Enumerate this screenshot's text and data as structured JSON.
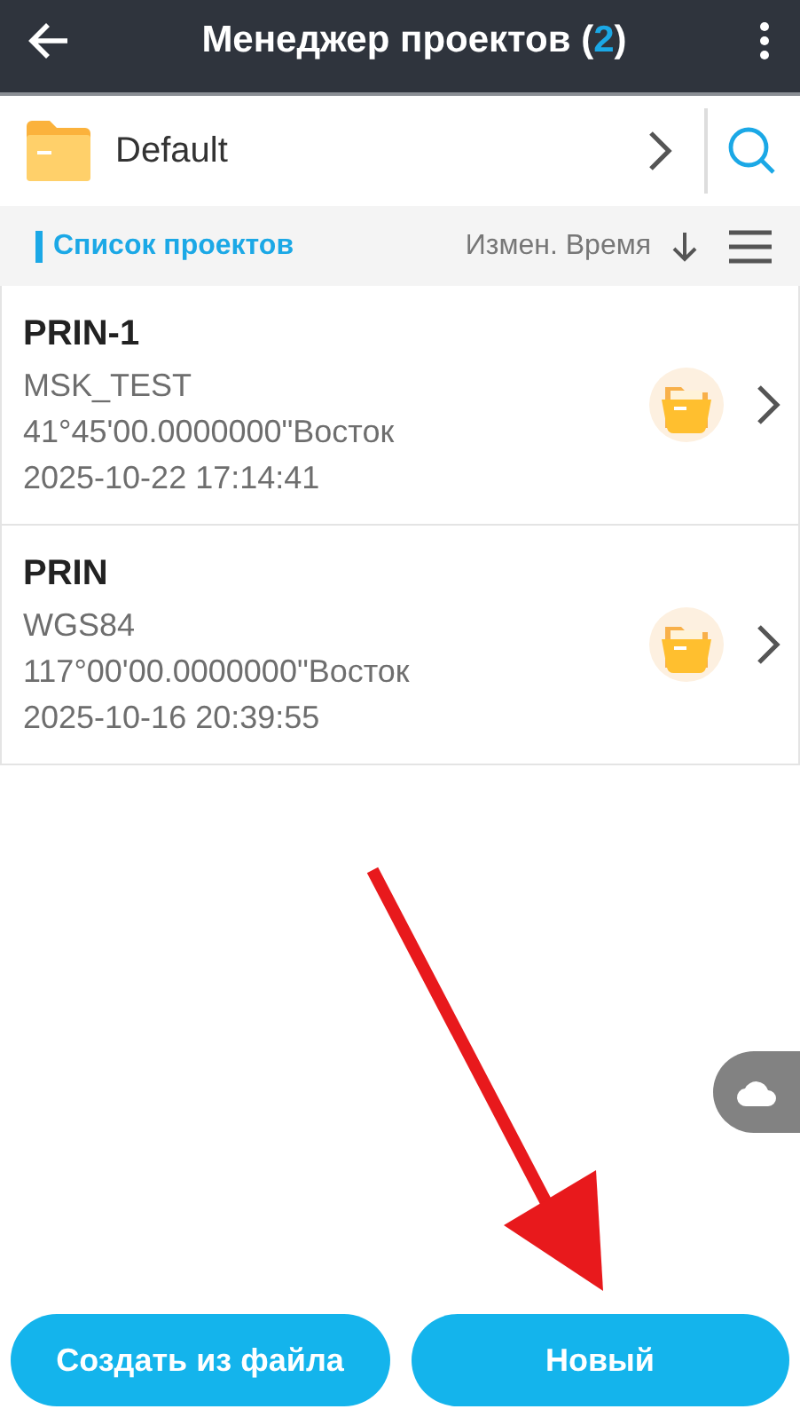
{
  "header": {
    "title_start": "Менеджер проектов (",
    "count": "2",
    "title_end": ")"
  },
  "folder": {
    "name": "Default"
  },
  "list_bar": {
    "title": "Список проектов",
    "sort_label": "Измен. Время"
  },
  "projects": [
    {
      "name": "PRIN-1",
      "system": "MSK_TEST",
      "meridian": "41°45'00.0000000\"Восток",
      "time": "2025-10-22 17:14:41"
    },
    {
      "name": "PRIN",
      "system": "WGS84",
      "meridian": "117°00'00.0000000\"Восток",
      "time": "2025-10-16 20:39:55"
    }
  ],
  "buttons": [
    {
      "label": "Создать из файла"
    },
    {
      "label": "Новый"
    }
  ]
}
